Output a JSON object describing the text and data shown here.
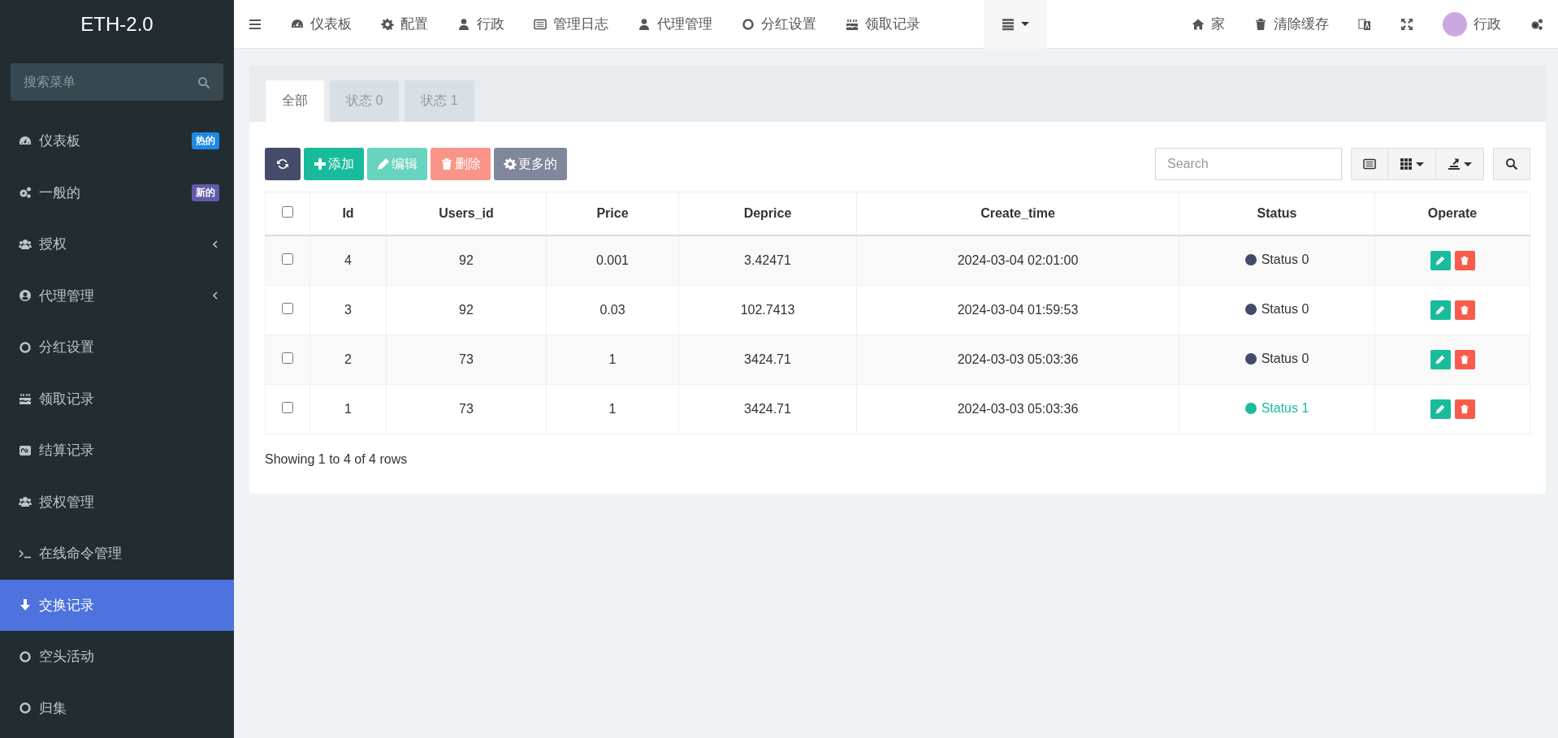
{
  "brand": "ETH-2.0",
  "sidebar": {
    "search": {
      "placeholder": "搜索菜单"
    },
    "items": [
      {
        "label": "仪表板",
        "selected": false,
        "badge": {
          "text": "热的",
          "color": "#1e88e5"
        }
      },
      {
        "label": "一般的",
        "selected": false,
        "badge": {
          "text": "新的",
          "color": "#605ca8"
        }
      },
      {
        "label": "授权",
        "selected": false,
        "expanded": false
      },
      {
        "label": "代理管理",
        "selected": false,
        "expanded": false
      },
      {
        "label": "分红设置",
        "selected": false
      },
      {
        "label": "领取记录",
        "selected": false
      },
      {
        "label": "结算记录",
        "selected": false
      },
      {
        "label": "授权管理",
        "selected": false
      },
      {
        "label": "在线命令管理",
        "selected": false
      },
      {
        "label": "交换记录",
        "selected": true
      },
      {
        "label": "空头活动",
        "selected": false
      },
      {
        "label": "归集",
        "selected": false
      }
    ]
  },
  "topnav": {
    "items": [
      "仪表板",
      "配置",
      "行政",
      "管理日志",
      "代理管理",
      "分红设置",
      "领取记录"
    ],
    "right": {
      "home": "家",
      "clear_cache": "清除缓存",
      "user": "行政"
    }
  },
  "tabs": [
    {
      "label": "全部",
      "selected": true
    },
    {
      "label": "状态 0",
      "selected": false
    },
    {
      "label": "状态 1",
      "selected": false
    }
  ],
  "toolbar": {
    "buttons": [
      {
        "kind": "refresh",
        "disabled": false
      },
      {
        "kind": "add",
        "label": "添加",
        "disabled": false
      },
      {
        "kind": "edit",
        "label": "编辑",
        "disabled": true
      },
      {
        "kind": "delete",
        "label": "删除",
        "disabled": true
      },
      {
        "kind": "more",
        "label": "更多的",
        "disabled": false
      }
    ],
    "search": {
      "placeholder": "Search"
    }
  },
  "table": {
    "select_all": {
      "checked": false
    },
    "columns": [
      "Id",
      "Users_id",
      "Price",
      "Deprice",
      "Create_time",
      "Status",
      "Operate"
    ],
    "rows": [
      {
        "checked": false,
        "cells": [
          "4",
          "92",
          "0.001",
          "3.42471",
          "2024-03-04 02:01:00"
        ],
        "status": {
          "label": "Status 0",
          "kind": "default",
          "color": "#434a6a"
        }
      },
      {
        "checked": false,
        "cells": [
          "3",
          "92",
          "0.03",
          "102.7413",
          "2024-03-04 01:59:53"
        ],
        "status": {
          "label": "Status 0",
          "kind": "default",
          "color": "#434a6a"
        }
      },
      {
        "checked": false,
        "cells": [
          "2",
          "73",
          "1",
          "3424.71",
          "2024-03-03 05:03:36"
        ],
        "status": {
          "label": "Status 0",
          "kind": "default",
          "color": "#434a6a"
        }
      },
      {
        "checked": false,
        "cells": [
          "1",
          "73",
          "1",
          "3424.71",
          "2024-03-03 05:03:36"
        ],
        "status": {
          "label": "Status 1",
          "kind": "success",
          "color": "#1abc9c"
        }
      }
    ]
  },
  "pagination": {
    "summary": "Showing 1 to 4 of 4 rows"
  }
}
